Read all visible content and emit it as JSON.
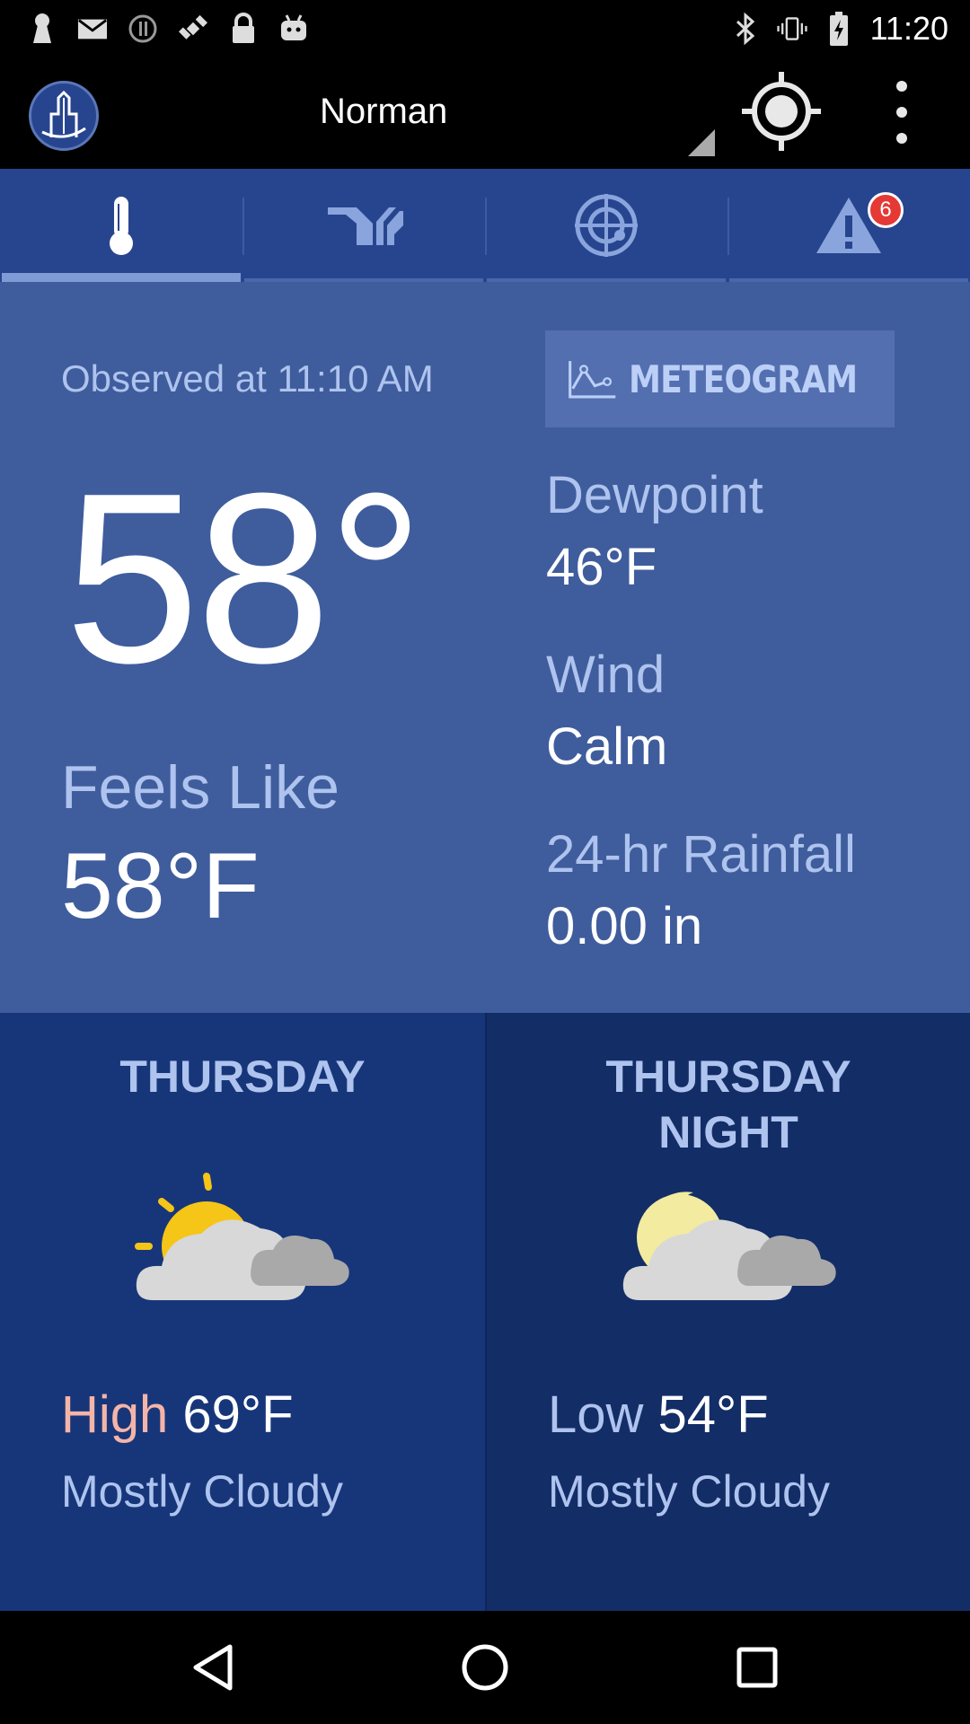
{
  "status_bar": {
    "time": "11:20",
    "left_icons": [
      "keyhole-icon",
      "mail-icon",
      "info-icon",
      "satellite-icon",
      "lock-icon",
      "android-icon"
    ],
    "right_icons": [
      "bluetooth-icon",
      "vibrate-icon",
      "battery-icon"
    ]
  },
  "app_bar": {
    "title": "Norman"
  },
  "tabs": [
    {
      "icon": "thermometer-icon",
      "active": true
    },
    {
      "icon": "forecast-stripes-icon",
      "active": false
    },
    {
      "icon": "radar-icon",
      "active": false
    },
    {
      "icon": "alert-icon",
      "active": false,
      "badge": "6"
    }
  ],
  "current": {
    "observed": "Observed at 11:10 AM",
    "meteogram_label": "METEOGRAM",
    "temperature": "58°",
    "feels_like_label": "Feels Like",
    "feels_like_value": "58°F",
    "dewpoint_label": "Dewpoint",
    "dewpoint_value": "46°F",
    "wind_label": "Wind",
    "wind_value": "Calm",
    "rainfall_label": "24-hr Rainfall",
    "rainfall_value": "0.00 in"
  },
  "forecast": {
    "day": {
      "title": "THURSDAY",
      "temp_label": "High",
      "temp_value": "69°F",
      "condition": "Mostly Cloudy",
      "icon": "partly-cloudy-day-icon"
    },
    "night": {
      "title_line1": "THURSDAY",
      "title_line2": "NIGHT",
      "temp_label": "Low",
      "temp_value": "54°F",
      "condition": "Mostly Cloudy",
      "icon": "partly-cloudy-night-icon"
    }
  },
  "colors": {
    "tab_bar": "#27458f",
    "current_bg": "#3f5d9d",
    "forecast_day_bg": "#17367a",
    "forecast_night_bg": "#132d67",
    "label_blue": "#aec3ee",
    "high_label": "#f5b4a8",
    "badge_red": "#e53935"
  }
}
